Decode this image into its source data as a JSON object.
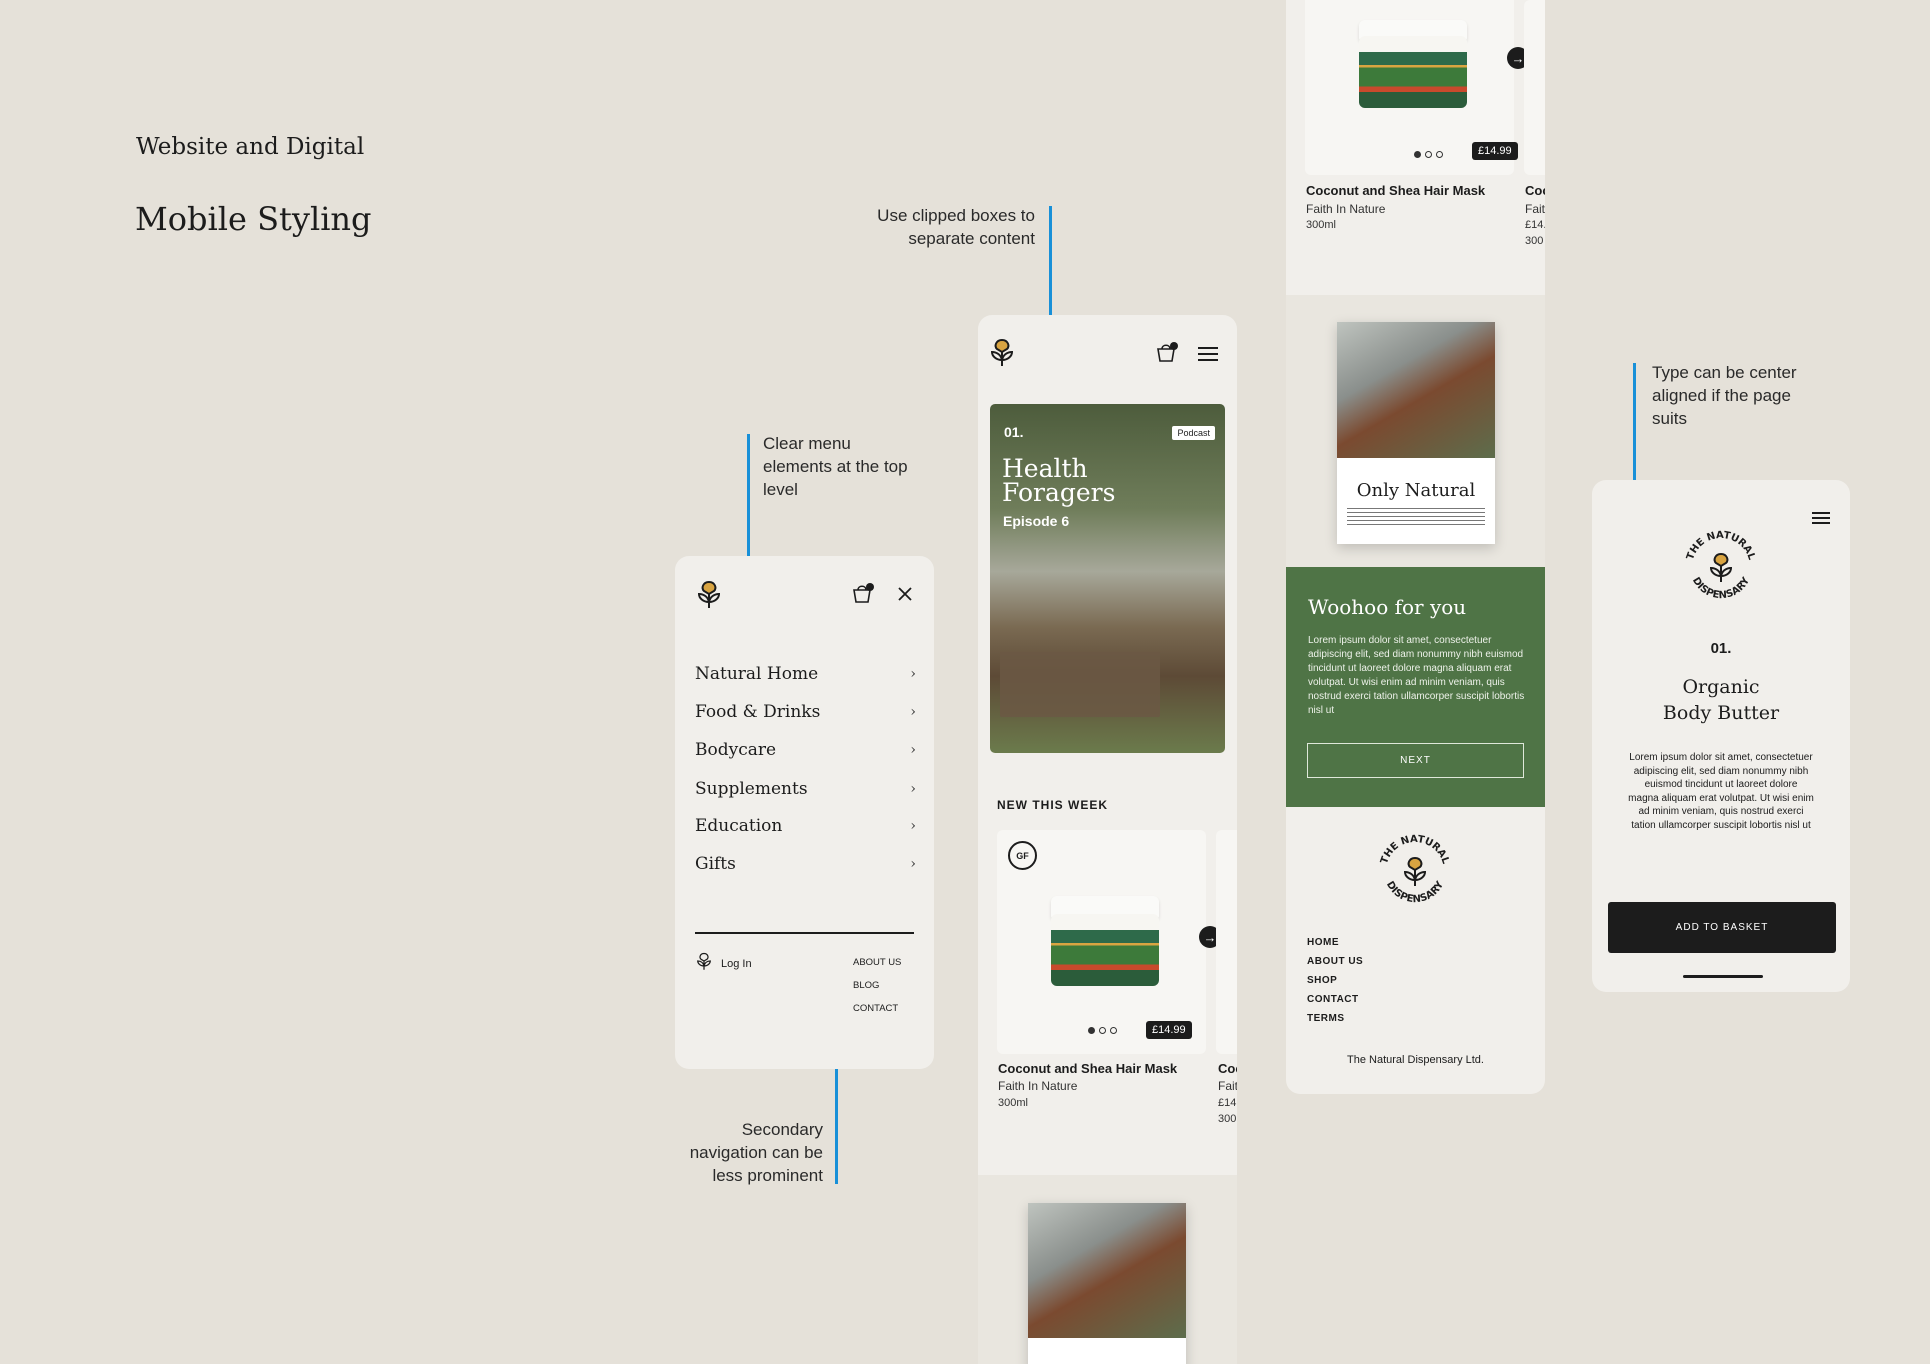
{
  "header": {
    "section": "Website and Digital",
    "title": "Mobile Styling"
  },
  "annotations": {
    "clipped": "Use clipped boxes to separate content",
    "menu_top": "Clear menu elements at the top level",
    "secondary_nav": "Secondary navigation can be less prominent",
    "center_type": "Type can be center aligned if the page suits"
  },
  "menu_phone": {
    "cart_count": "0",
    "items": [
      {
        "label": "Natural Home"
      },
      {
        "label": "Food & Drinks"
      },
      {
        "label": "Bodycare"
      },
      {
        "label": "Supplements"
      },
      {
        "label": "Education"
      },
      {
        "label": "Gifts"
      }
    ],
    "login": "Log In",
    "secondary": [
      "ABOUT US",
      "BLOG",
      "CONTACT"
    ]
  },
  "podcast_phone": {
    "cart_count": "0",
    "hero": {
      "number": "01.",
      "title_line1": "Health",
      "title_line2": "Foragers",
      "episode": "Episode 6",
      "badge": "Podcast"
    },
    "section_title": "NEW THIS WEEK",
    "product": {
      "badge": "GF",
      "price": "£14.99",
      "name": "Coconut and Shea Hair Mask",
      "brand": "Faith In Nature",
      "volume": "300ml",
      "next_name": "Coc",
      "next_brand": "Faitl",
      "next_price": "£14.",
      "next_volume": "300r"
    }
  },
  "long_phone": {
    "product": {
      "price": "£14.99",
      "name": "Coconut and Shea Hair Mask",
      "brand": "Faith In Nature",
      "volume": "300ml",
      "next_name": "Coc",
      "next_brand": "Fait",
      "next_price": "£14.",
      "next_volume": "300"
    },
    "book_title": "Only Natural",
    "promo": {
      "title": "Woohoo for you",
      "body": "Lorem ipsum dolor sit amet, consectetuer adipiscing elit, sed diam nonummy nibh euismod tincidunt ut laoreet dolore magna aliquam erat volutpat. Ut wisi enim ad minim veniam, quis nostrud exerci tation ullamcorper suscipit lobortis nisl ut",
      "button": "NEXT"
    },
    "footer_links": [
      "HOME",
      "ABOUT US",
      "SHOP",
      "CONTACT",
      "TERMS"
    ],
    "company": "The Natural Dispensary Ltd."
  },
  "product_phone": {
    "number": "01.",
    "title_line1": "Organic",
    "title_line2": "Body Butter",
    "body": "Lorem ipsum dolor sit amet, consectetuer adipiscing elit, sed diam nonummy nibh euismod tincidunt ut laoreet dolore magna aliquam erat volutpat. Ut wisi enim ad minim veniam, quis nostrud exerci tation ullamcorper suscipit lobortis nisl ut",
    "button": "ADD TO BASKET"
  },
  "brand": {
    "logo_top": "THE NATURAL",
    "logo_bottom": "DISPENSARY"
  },
  "colors": {
    "accent_blue": "#1890d8",
    "forest_green": "#4f7446",
    "dark": "#1c1c1c",
    "gold": "#d9a441",
    "background": "#e5e1d9"
  }
}
